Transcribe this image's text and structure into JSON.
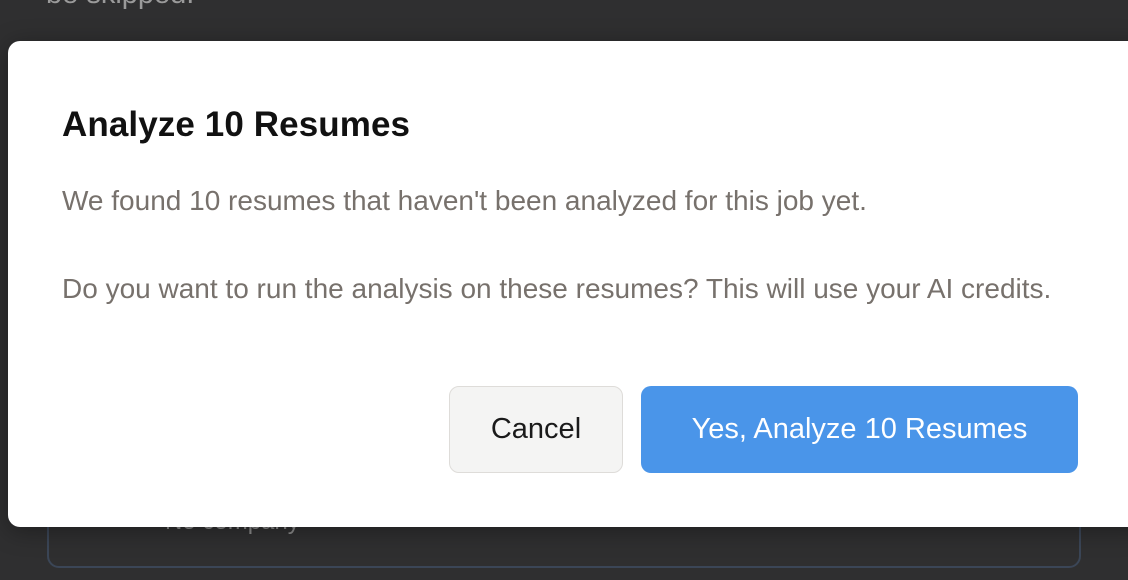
{
  "background": {
    "partial_text": "be skipped.",
    "card_text": "No company"
  },
  "dialog": {
    "title": "Analyze 10 Resumes",
    "message_1": "We found 10 resumes that haven't been analyzed for this job yet.",
    "message_2": "Do you want to run the analysis on these resumes? This will use your AI credits.",
    "cancel_label": "Cancel",
    "confirm_label": "Yes, Analyze 10 Resumes"
  },
  "colors": {
    "overlay": "#2f2f30",
    "primary": "#4a95e9",
    "secondary_bg": "#f4f4f3",
    "body_text": "#77716c"
  }
}
